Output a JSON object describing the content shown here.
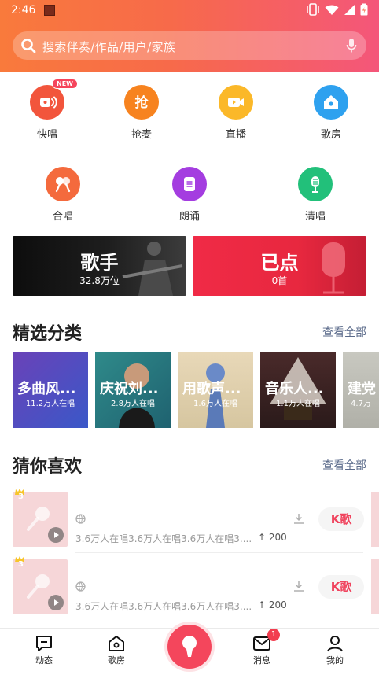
{
  "status": {
    "time": "2:46"
  },
  "search": {
    "placeholder": "搜索伴奏/作品/用户/家族"
  },
  "grid_row1": [
    {
      "label": "快唱",
      "icon": "quick-sing-icon",
      "badge": "NEW"
    },
    {
      "label": "抢麦",
      "icon": "grab-mic-icon"
    },
    {
      "label": "直播",
      "icon": "live-icon"
    },
    {
      "label": "歌房",
      "icon": "song-room-icon"
    }
  ],
  "grid_row2": [
    {
      "label": "合唱",
      "icon": "chorus-icon"
    },
    {
      "label": "朗诵",
      "icon": "recite-icon"
    },
    {
      "label": "清唱",
      "icon": "a-cappella-icon"
    }
  ],
  "banners": [
    {
      "title": "歌手",
      "subtitle": "32.8万位"
    },
    {
      "title": "已点",
      "subtitle": "0首"
    }
  ],
  "categories_section": {
    "title": "精选分类",
    "see_all": "查看全部",
    "items": [
      {
        "title": "多曲风...",
        "subtitle": "11.2万人在唱"
      },
      {
        "title": "庆祝刘...",
        "subtitle": "2.8万人在唱"
      },
      {
        "title": "用歌声...",
        "subtitle": "1.6万人在唱"
      },
      {
        "title": "音乐人...",
        "subtitle": "1.1万人在唱"
      },
      {
        "title": "建党",
        "subtitle": "4.7万"
      }
    ]
  },
  "recommend_section": {
    "title": "猜你喜欢",
    "see_all": "查看全部",
    "songs": [
      {
        "rank": "3",
        "meta": "3.6万人在唱3.6万人在唱3.6万人在唱3....",
        "up": "200",
        "action": "K歌"
      },
      {
        "rank": "3",
        "meta": "3.6万人在唱3.6万人在唱3.6万人在唱3....",
        "up": "200",
        "action": "K歌"
      }
    ]
  },
  "bottom_nav": {
    "items": [
      {
        "label": "动态",
        "icon": "feed-icon"
      },
      {
        "label": "歌房",
        "icon": "song-room-icon"
      },
      {
        "label": "消息",
        "icon": "message-icon",
        "badge": "1"
      },
      {
        "label": "我的",
        "icon": "profile-icon"
      }
    ],
    "center_icon": "mic-record-icon"
  },
  "colors": {
    "header_start": "#f97a3c",
    "header_end": "#f4567a",
    "accent": "#f4465c",
    "link": "#5a6a8a"
  }
}
